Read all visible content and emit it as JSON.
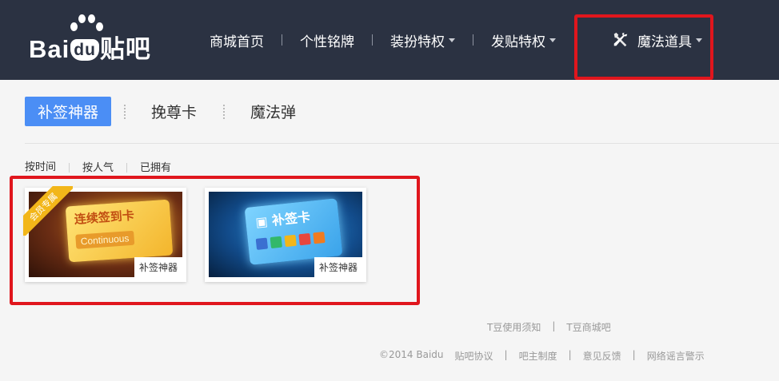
{
  "header": {
    "logo": "Baidu贴吧",
    "nav": [
      {
        "label": "商城首页",
        "dropdown": false
      },
      {
        "label": "个性铭牌",
        "dropdown": false
      },
      {
        "label": "装扮特权",
        "dropdown": true
      },
      {
        "label": "发贴特权",
        "dropdown": true
      },
      {
        "label": "魔法道具",
        "dropdown": true,
        "icon": "tools-icon",
        "highlighted": true
      }
    ]
  },
  "subtabs": [
    {
      "label": "补签神器",
      "active": true
    },
    {
      "label": "挽尊卡",
      "active": false
    },
    {
      "label": "魔法弹",
      "active": false
    }
  ],
  "sort_tabs": [
    {
      "label": "按时间",
      "active": true
    },
    {
      "label": "按人气",
      "active": false
    },
    {
      "label": "已拥有",
      "active": false
    }
  ],
  "products": [
    {
      "name": "补签神器",
      "art_title": "连续签到卡",
      "art_subtitle": "Continuous",
      "badge": "会员专属"
    },
    {
      "name": "补签神器",
      "art_title": "补签卡"
    }
  ],
  "footer": {
    "line1": [
      "T豆使用须知",
      "|",
      "T豆商城吧"
    ],
    "line2": [
      "©2014 Baidu",
      "贴吧协议",
      "|",
      "吧主制度",
      "|",
      "意见反馈",
      "|",
      "网络谣言警示"
    ]
  },
  "colors": {
    "header_bg": "#2b3242",
    "accent": "#4b8ef5",
    "highlight": "#e0161d",
    "page_bg": "#f5f5f5"
  }
}
